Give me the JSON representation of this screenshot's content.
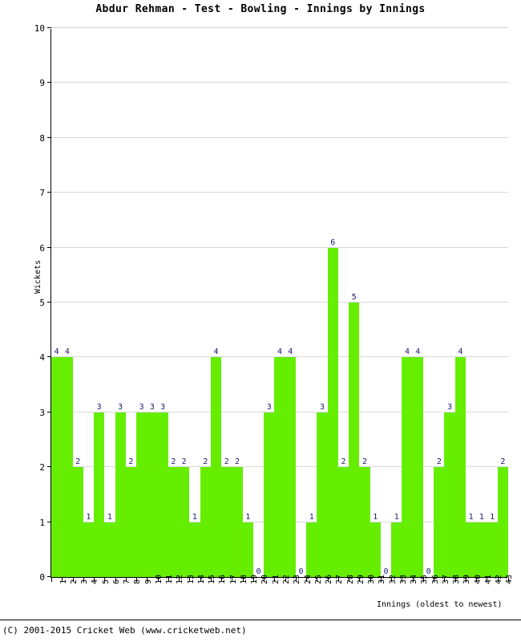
{
  "chart_data": {
    "type": "bar",
    "title": "Abdur Rehman - Test - Bowling - Innings by Innings",
    "xlabel": "Innings (oldest to newest)",
    "ylabel": "Wickets",
    "ylim": [
      0,
      10
    ],
    "yticks": [
      0,
      1,
      2,
      3,
      4,
      5,
      6,
      7,
      8,
      9,
      10
    ],
    "grid": true,
    "legend": null,
    "bar_color": "#66ee00",
    "label_color": "#191970",
    "categories": [
      "1",
      "2",
      "3",
      "4",
      "5",
      "6",
      "7",
      "8",
      "9",
      "10",
      "11",
      "12",
      "13",
      "14",
      "15",
      "16",
      "17",
      "18",
      "19",
      "20",
      "21",
      "22",
      "23",
      "24",
      "25",
      "26",
      "27",
      "28",
      "29",
      "30",
      "31",
      "32",
      "33",
      "34",
      "35",
      "36",
      "37",
      "38",
      "39",
      "40",
      "41",
      "42",
      "43"
    ],
    "values": [
      4,
      4,
      2,
      1,
      3,
      1,
      3,
      2,
      3,
      3,
      3,
      2,
      2,
      1,
      2,
      4,
      2,
      2,
      1,
      0,
      3,
      4,
      4,
      0,
      1,
      3,
      6,
      2,
      5,
      2,
      1,
      0,
      1,
      4,
      4,
      0,
      2,
      3,
      4,
      1,
      1,
      1,
      2
    ],
    "value_labels": [
      "4",
      "4",
      "2",
      "1",
      "3",
      "1",
      "3",
      "2",
      "3",
      "3",
      "3",
      "2",
      "2",
      "1",
      "2",
      "4",
      "2",
      "2",
      "1",
      "0",
      "3",
      "4",
      "4",
      "0",
      "1",
      "3",
      "6",
      "2",
      "5",
      "2",
      "1",
      "0",
      "1",
      "4",
      "4",
      "0",
      "2",
      "3",
      "4",
      "1",
      "1",
      "1",
      "2"
    ]
  },
  "footer": {
    "copyright": "(C) 2001-2015 Cricket Web (www.cricketweb.net)"
  }
}
